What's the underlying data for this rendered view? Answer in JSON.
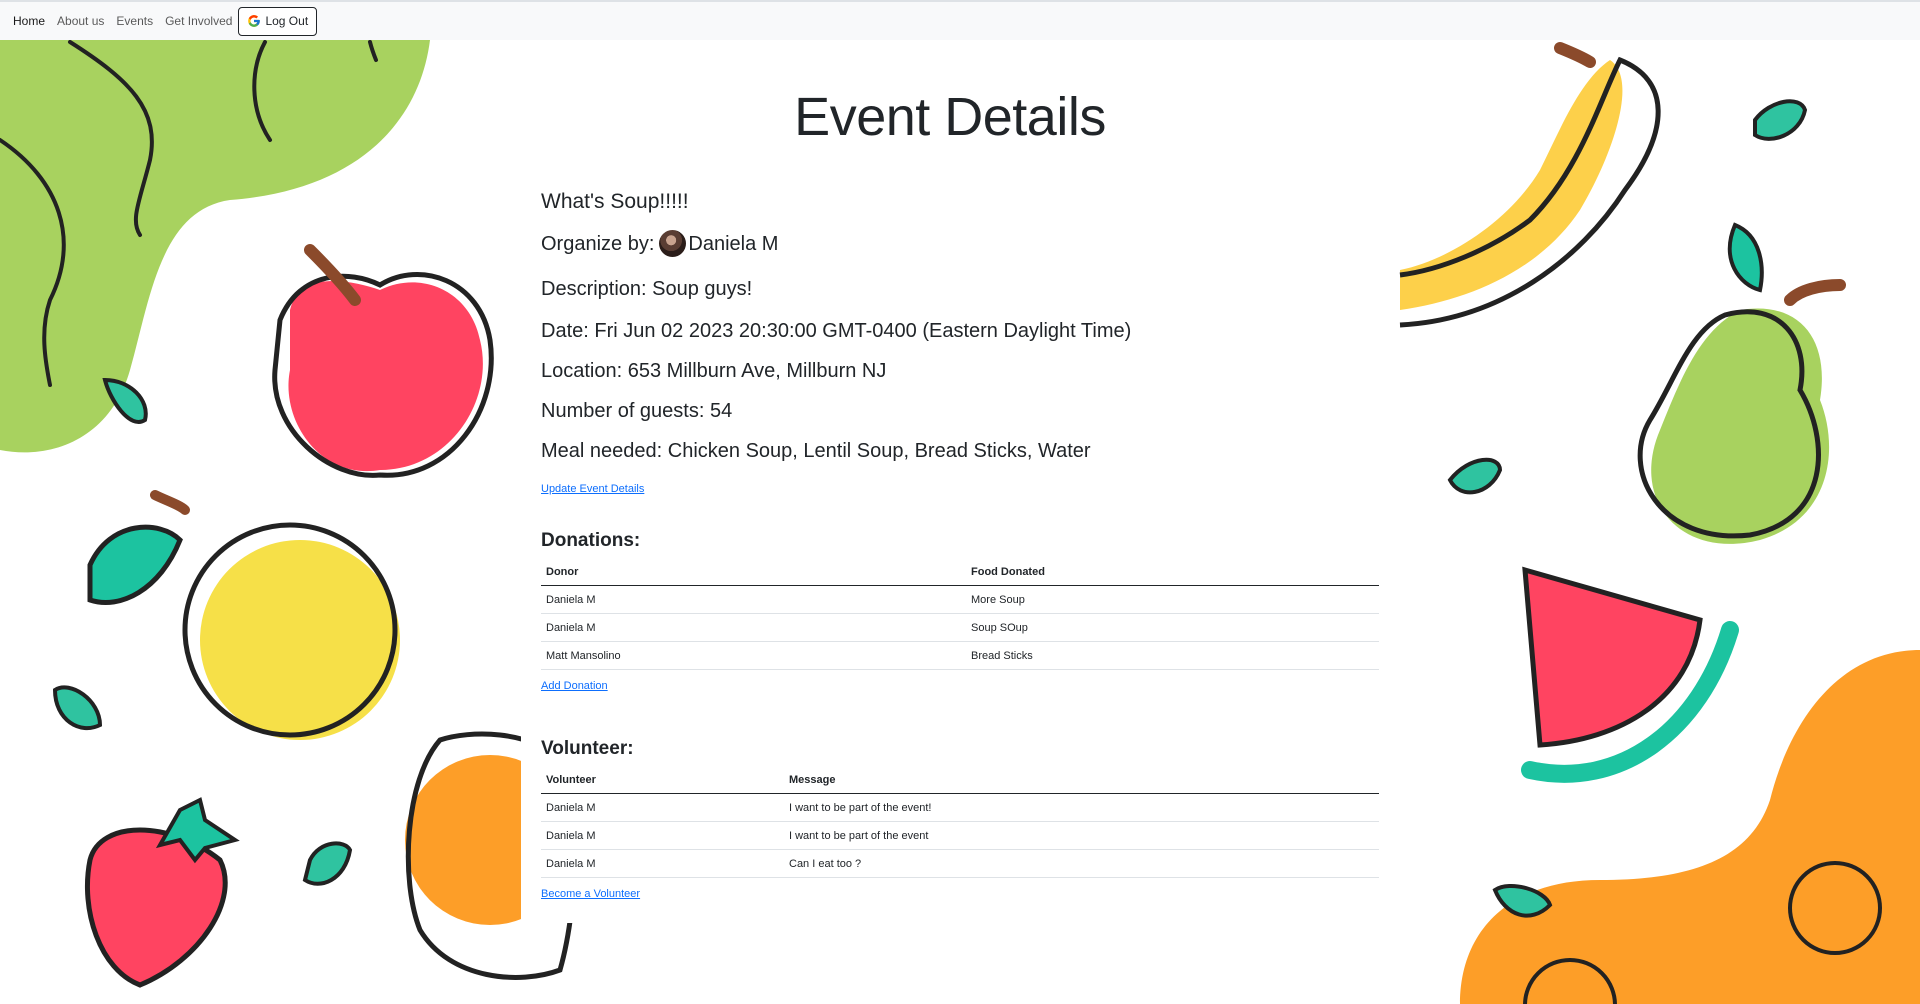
{
  "nav": {
    "items": [
      "Home",
      "About us",
      "Events",
      "Get Involved"
    ],
    "logout_label": "Log Out"
  },
  "page": {
    "title": "Event Details"
  },
  "event": {
    "name": "What's Soup!!!!!",
    "organizer_prefix": "Organize by:",
    "organizer_name": "Daniela M",
    "description": "Description: Soup guys!",
    "date": "Date: Fri Jun 02 2023 20:30:00 GMT-0400 (Eastern Daylight Time)",
    "location": "Location: 653 Millburn Ave, Millburn NJ",
    "guests": "Number of guests: 54",
    "meal": "Meal needed: Chicken Soup, Lentil Soup, Bread Sticks, Water",
    "update_link": "Update Event Details"
  },
  "donations": {
    "title": "Donations:",
    "headers": [
      "Donor",
      "Food Donated"
    ],
    "rows": [
      [
        "Daniela M",
        "More Soup"
      ],
      [
        "Daniela M",
        "Soup SOup"
      ],
      [
        "Matt Mansolino",
        "Bread Sticks"
      ]
    ],
    "add_link": "Add Donation"
  },
  "volunteers": {
    "title": "Volunteer:",
    "headers": [
      "Volunteer",
      "Message"
    ],
    "rows": [
      [
        "Daniela M",
        "I want to be part of the event!"
      ],
      [
        "Daniela M",
        "I want to be part of the event"
      ],
      [
        "Daniela M",
        "Can I eat too ?"
      ]
    ],
    "become_link": "Become a Volunteer"
  },
  "colors": {
    "link": "#0d6efd",
    "text": "#212529",
    "lime": "#a8d25f",
    "orange": "#fd9e28",
    "red": "#ff4461",
    "yellow": "#fdd04a",
    "lemon": "#f6e048",
    "teal": "#1cc3a0"
  }
}
